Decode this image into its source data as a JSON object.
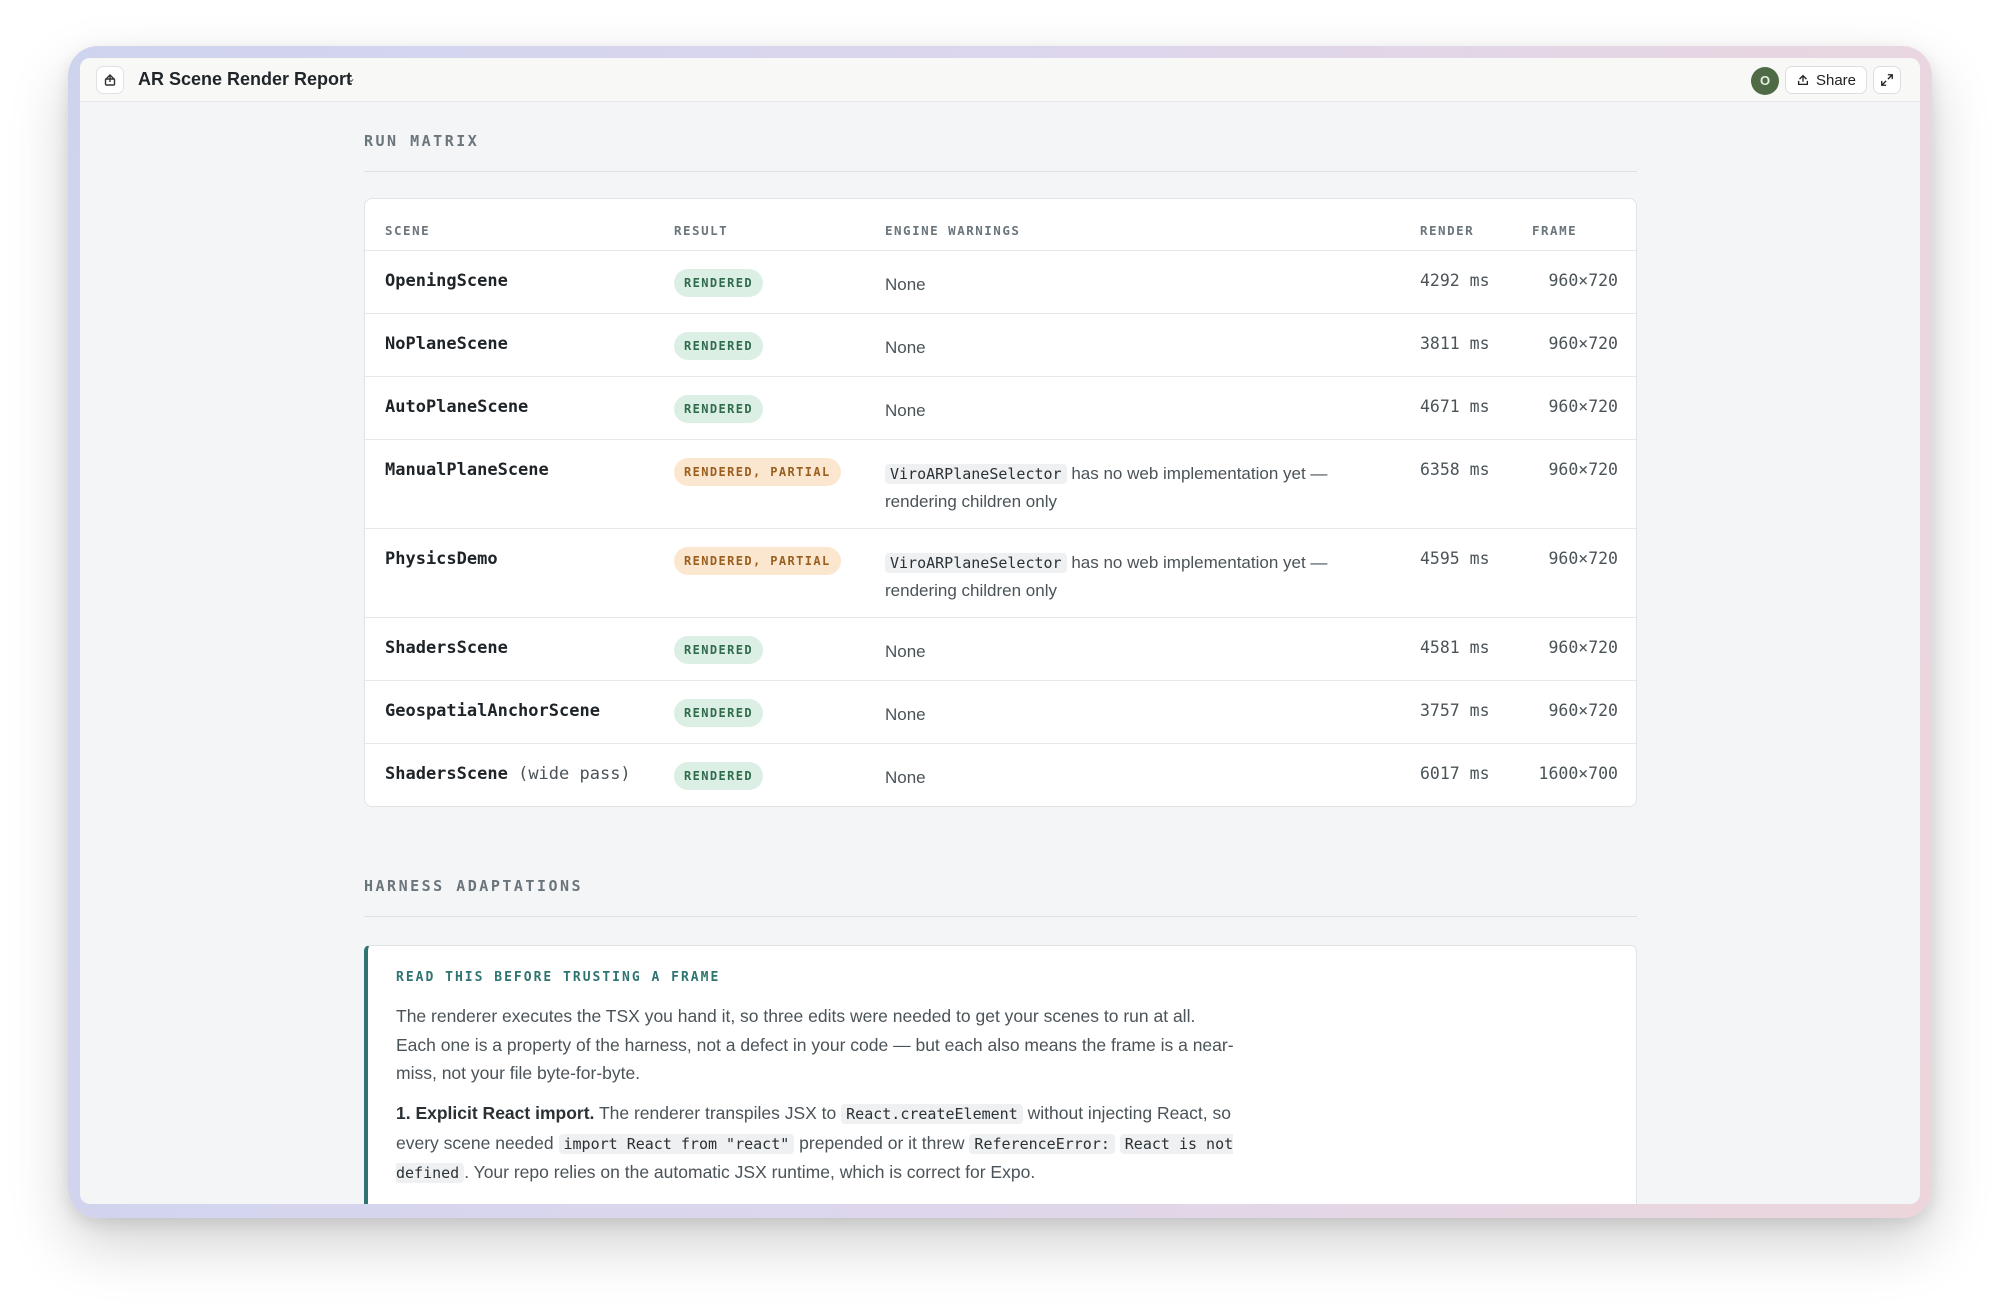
{
  "window": {
    "title": "AR Scene Render Report",
    "avatar_initial": "O",
    "share_label": "Share"
  },
  "run_matrix": {
    "section_label": "RUN MATRIX",
    "headers": {
      "scene": "SCENE",
      "result": "RESULT",
      "warnings": "ENGINE WARNINGS",
      "render": "RENDER",
      "frame": "FRAME"
    },
    "rows": [
      {
        "scene": "OpeningScene",
        "scene_suffix": "",
        "result": "RENDERED",
        "warning": "None",
        "render": "4292 ms",
        "frame": "960×720"
      },
      {
        "scene": "NoPlaneScene",
        "scene_suffix": "",
        "result": "RENDERED",
        "warning": "None",
        "render": "3811 ms",
        "frame": "960×720"
      },
      {
        "scene": "AutoPlaneScene",
        "scene_suffix": "",
        "result": "RENDERED",
        "warning": "None",
        "render": "4671 ms",
        "frame": "960×720"
      },
      {
        "scene": "ManualPlaneScene",
        "scene_suffix": "",
        "result": "RENDERED, PARTIAL",
        "warning_code": "ViroARPlaneSelector",
        "warning": "has no web implementation yet — rendering children only",
        "render": "6358 ms",
        "frame": "960×720"
      },
      {
        "scene": "PhysicsDemo",
        "scene_suffix": "",
        "result": "RENDERED, PARTIAL",
        "warning_code": "ViroARPlaneSelector",
        "warning": "has no web implementation yet — rendering children only",
        "render": "4595 ms",
        "frame": "960×720"
      },
      {
        "scene": "ShadersScene",
        "scene_suffix": "",
        "result": "RENDERED",
        "warning": "None",
        "render": "4581 ms",
        "frame": "960×720"
      },
      {
        "scene": "GeospatialAnchorScene",
        "scene_suffix": "",
        "result": "RENDERED",
        "warning": "None",
        "render": "3757 ms",
        "frame": "960×720"
      },
      {
        "scene": "ShadersScene",
        "scene_suffix": "(wide pass)",
        "result": "RENDERED",
        "warning": "None",
        "render": "6017 ms",
        "frame": "1600×700"
      }
    ]
  },
  "harness": {
    "section_label": "HARNESS ADAPTATIONS",
    "callout_title": "READ THIS BEFORE TRUSTING A FRAME",
    "intro": "The renderer executes the TSX you hand it, so three edits were needed to get your scenes to run at all. Each one is a property of the harness, not a defect in your code — but each also means the frame is a near-miss, not your file byte-for-byte.",
    "item1": {
      "lead": "1. Explicit React import.",
      "t1": "The renderer transpiles JSX to",
      "c1": "React.createElement",
      "t2": "without injecting React, so every scene needed",
      "c2": "import React from \"react\"",
      "t3": "prepended or it threw",
      "c3a": "ReferenceError:",
      "c3b": "React is not defined",
      "t4": ". Your repo relies on the automatic JSX runtime, which is correct for Expo."
    }
  }
}
